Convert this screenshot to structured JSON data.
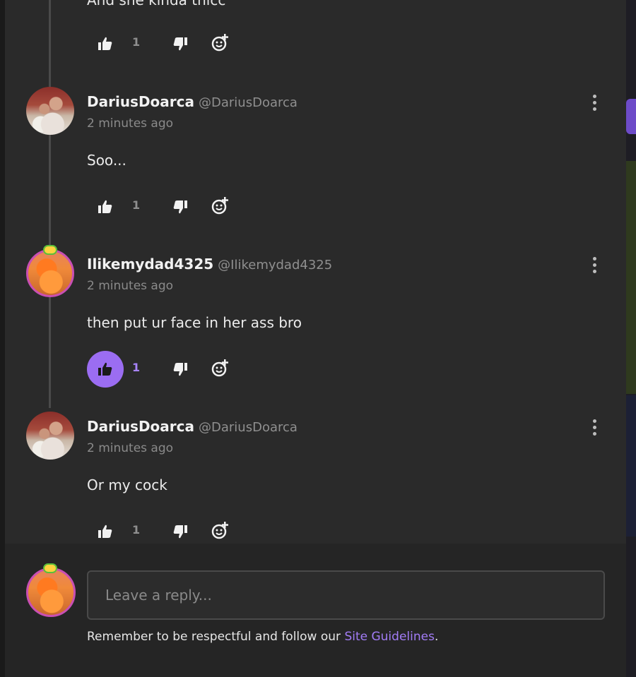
{
  "thread": {
    "partial_prev_text": "And she kinda thicc",
    "partial_prev_likes": "1",
    "comments": [
      {
        "username": "DariusDoarca",
        "handle": "@DariusDoarca",
        "time": "2 minutes ago",
        "text": "Soo...",
        "likes": "1",
        "liked": false,
        "avatar": "darius-avatar"
      },
      {
        "username": "Ilikemydad4325",
        "handle": "@Ilikemydad4325",
        "time": "2 minutes ago",
        "text": "then put ur face in her ass bro",
        "likes": "1",
        "liked": true,
        "avatar": "bird-avatar"
      },
      {
        "username": "DariusDoarca",
        "handle": "@DariusDoarca",
        "time": "2 minutes ago",
        "text": "Or my cock",
        "likes": "1",
        "liked": false,
        "avatar": "darius-avatar"
      }
    ]
  },
  "reply": {
    "placeholder": "Leave a reply...",
    "guidelines_prefix": "Remember to be respectful and follow our ",
    "guidelines_link": "Site Guidelines",
    "guidelines_suffix": "."
  },
  "colors": {
    "accent": "#9b6df2",
    "link": "#a27cf6",
    "panel": "#2a2a2a"
  }
}
